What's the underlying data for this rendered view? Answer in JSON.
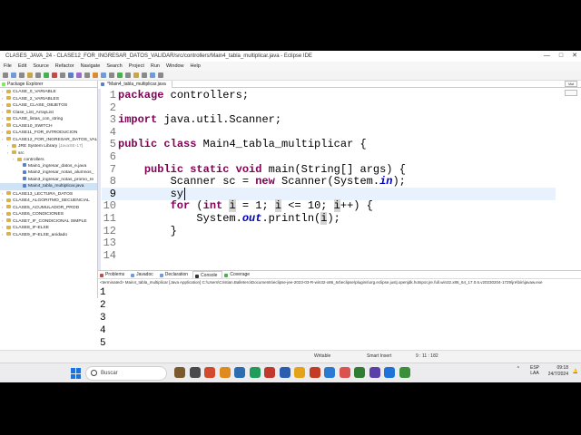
{
  "window": {
    "title": "CLASES_JAVA_24 - CLASE12_FOR_INGRESAR_DATOS_VALIDAR/src/controllers/Main4_tabla_multiplicar.java - Eclipse IDE",
    "minimize": "—",
    "maximize": "□",
    "close": "✕"
  },
  "menu": [
    "File",
    "Edit",
    "Source",
    "Refactor",
    "Navigate",
    "Search",
    "Project",
    "Run",
    "Window",
    "Help"
  ],
  "package_explorer": {
    "tab_label": "Package Explorer",
    "items": [
      {
        "label": "CLASE_0_VARIABLE",
        "type": "project",
        "indent": 0
      },
      {
        "label": "CLASE_2_VARIABLES",
        "type": "project",
        "indent": 0
      },
      {
        "label": "CLASE_CLASE_OBJETOS",
        "type": "project",
        "indent": 0
      },
      {
        "label": "Clase_List_ArrayList",
        "type": "project",
        "indent": 0
      },
      {
        "label": "CLASE_listas_con_string",
        "type": "project",
        "indent": 0
      },
      {
        "label": "CLASE10_SWITCH",
        "type": "project",
        "indent": 0
      },
      {
        "label": "CLASE11_FOR_INTRODUCION",
        "type": "project",
        "indent": 0
      },
      {
        "label": "CLASE12_FOR_INGRESAR_DATOS_VALIDA",
        "type": "project",
        "indent": 0
      },
      {
        "label": "JRE System Library",
        "suffix": "[JavaSE-17]",
        "type": "lib",
        "indent": 1
      },
      {
        "label": "src",
        "type": "folder",
        "indent": 1
      },
      {
        "label": "controllers",
        "type": "folder",
        "indent": 2
      },
      {
        "label": "Main1_ingresar_datos_e.java",
        "type": "file",
        "indent": 3
      },
      {
        "label": "Main2_ingresar_notas_alumnos_",
        "type": "file",
        "indent": 3
      },
      {
        "label": "Main3_ingresar_notas_promo_re",
        "type": "file",
        "indent": 3
      },
      {
        "label": "Main4_tabla_multiplicar.java",
        "type": "file",
        "indent": 3,
        "selected": true
      },
      {
        "label": "CLASE13_LECTURA_DATOS",
        "type": "project",
        "indent": 0
      },
      {
        "label": "CLASE4_ALGORITMO_SECUENCIAL",
        "type": "project",
        "indent": 0
      },
      {
        "label": "CLASE5_ACUMULADOR_PROD",
        "type": "project",
        "indent": 0
      },
      {
        "label": "CLASE6_CONDICIONES",
        "type": "project",
        "indent": 0
      },
      {
        "label": "CLASE7_IF_CONDICIONAL SIMPLE",
        "type": "project",
        "indent": 0
      },
      {
        "label": "CLASE8_IF-ELSE",
        "type": "project",
        "indent": 0
      },
      {
        "label": "CLASE9_IF-ELSE_anidado",
        "type": "project",
        "indent": 0
      }
    ]
  },
  "editor": {
    "tab_label": "*Main4_tabla_multiplicar.java",
    "lines": [
      {
        "n": "1",
        "parts": [
          {
            "t": "package",
            "c": "kw"
          },
          {
            "t": " controllers;"
          }
        ]
      },
      {
        "n": "2",
        "parts": []
      },
      {
        "n": "3",
        "parts": [
          {
            "t": "import",
            "c": "kw"
          },
          {
            "t": " java.util.Scanner;"
          }
        ]
      },
      {
        "n": "4",
        "parts": []
      },
      {
        "n": "5",
        "parts": [
          {
            "t": "public",
            "c": "kw"
          },
          {
            "t": " "
          },
          {
            "t": "class",
            "c": "kw"
          },
          {
            "t": " Main4_tabla_multiplicar {"
          }
        ]
      },
      {
        "n": "6",
        "parts": []
      },
      {
        "n": "7",
        "parts": [
          {
            "t": "    "
          },
          {
            "t": "public",
            "c": "kw"
          },
          {
            "t": " "
          },
          {
            "t": "static",
            "c": "kw"
          },
          {
            "t": " "
          },
          {
            "t": "void",
            "c": "kw"
          },
          {
            "t": " main(String[] args) {"
          }
        ]
      },
      {
        "n": "8",
        "parts": [
          {
            "t": "        Scanner sc = "
          },
          {
            "t": "new",
            "c": "kw"
          },
          {
            "t": " Scanner(System."
          },
          {
            "t": "in",
            "c": "fld"
          },
          {
            "t": ");"
          }
        ]
      },
      {
        "n": "9",
        "parts": [
          {
            "t": "        sy"
          }
        ],
        "current": true
      },
      {
        "n": "10",
        "parts": [
          {
            "t": "        "
          },
          {
            "t": "for",
            "c": "kw"
          },
          {
            "t": " ("
          },
          {
            "t": "int",
            "c": "kw"
          },
          {
            "t": " "
          },
          {
            "t": "i",
            "c": "var"
          },
          {
            "t": " = 1; "
          },
          {
            "t": "i",
            "c": "var"
          },
          {
            "t": " <= 10; "
          },
          {
            "t": "i",
            "c": "var"
          },
          {
            "t": "++) {"
          }
        ]
      },
      {
        "n": "11",
        "parts": [
          {
            "t": "            System."
          },
          {
            "t": "out",
            "c": "fld"
          },
          {
            "t": ".println("
          },
          {
            "t": "i",
            "c": "var"
          },
          {
            "t": ");"
          }
        ]
      },
      {
        "n": "12",
        "parts": [
          {
            "t": "        }"
          }
        ]
      },
      {
        "n": "13",
        "parts": []
      },
      {
        "n": "14",
        "parts": []
      }
    ]
  },
  "quick_access": "Mat",
  "console_panel": {
    "tabs": [
      "Problems",
      "Javadoc",
      "Declaration",
      "Console",
      "Coverage"
    ],
    "active_tab": "Console",
    "terminated_line": "<terminated> Main4_tabla_multiplicar [Java Application] C:\\Users\\Cristian.Balletero\\Documents\\eclipse-jee-2023-03-R-win32-x86_64\\eclipse\\plugins\\org.eclipse.justj.openjdk.hotspot.jre.full.win32.x86_64_17.0.6.v20230204-1729\\jre\\bin\\javaw.exe",
    "output": [
      "1",
      "2",
      "3",
      "4",
      "5"
    ]
  },
  "status_bar": {
    "mode": "Writable",
    "insert": "Smart Insert",
    "position": "9 : 11 : 182"
  },
  "taskbar": {
    "search_placeholder": "Buscar",
    "lang": "ESP",
    "layout": "LAA",
    "time": "09:18",
    "date": "24/7/2024"
  },
  "colors": {
    "keyword": "#7f0055",
    "field": "#0000c0",
    "current_line": "#e8f2fe",
    "selected_tree": "#cfe3f7"
  }
}
